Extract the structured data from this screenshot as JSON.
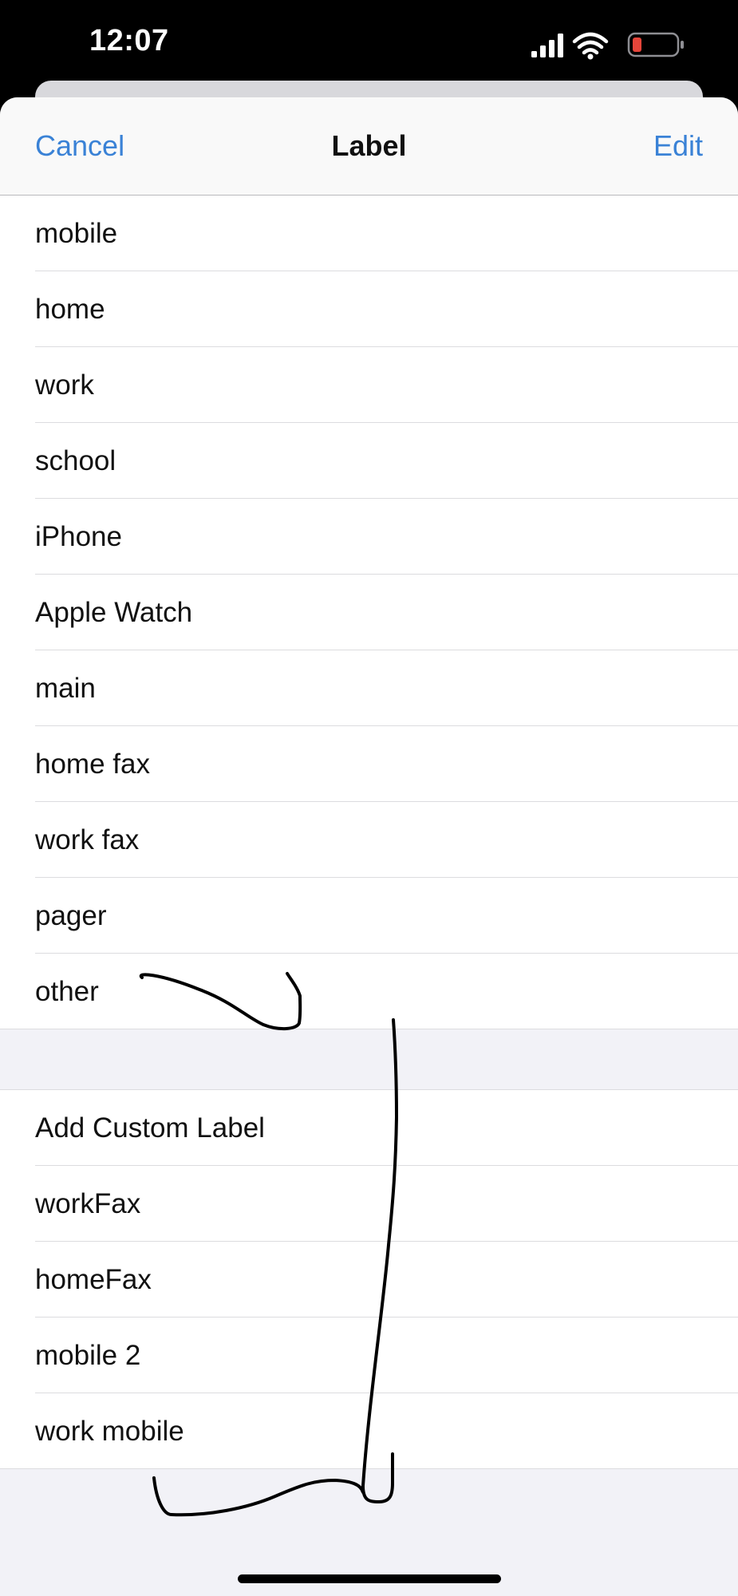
{
  "status_bar": {
    "time": "12:07",
    "icons": [
      "signal-icon",
      "wifi-icon",
      "battery-low-icon"
    ],
    "battery_color": "#e5453a"
  },
  "nav": {
    "cancel": "Cancel",
    "title": "Label",
    "edit": "Edit"
  },
  "standard_labels": [
    "mobile",
    "home",
    "work",
    "school",
    "iPhone",
    "Apple Watch",
    "main",
    "home fax",
    "work fax",
    "pager",
    "other"
  ],
  "custom_labels": [
    "Add Custom Label",
    "workFax",
    "homeFax",
    "mobile 2",
    "work mobile"
  ],
  "colors": {
    "accent": "#3a82d6",
    "grouped_background": "#f2f2f7",
    "row_background": "#ffffff"
  }
}
